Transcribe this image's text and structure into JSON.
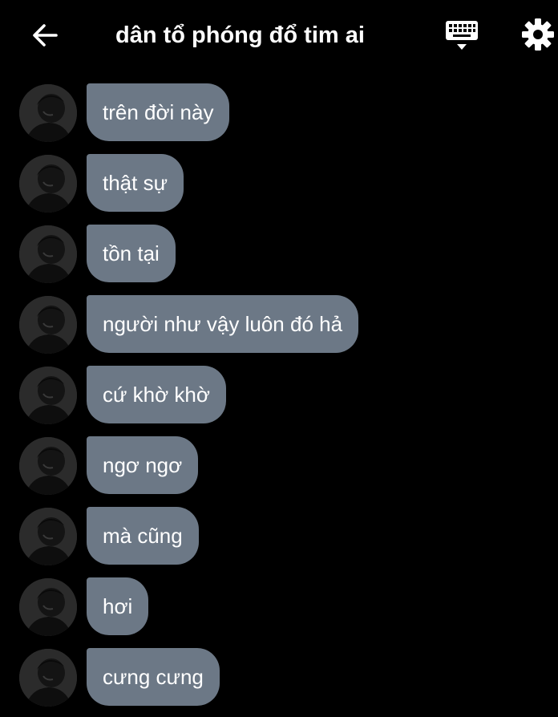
{
  "header": {
    "back_icon": "arrow-left-icon",
    "title": "dân tổ phóng đổ tim ai",
    "keyboard_icon": "keyboard-icon",
    "settings_icon": "gear-icon"
  },
  "colors": {
    "background": "#000000",
    "bubble": "#6c7886",
    "text": "#ffffff"
  },
  "messages": [
    {
      "text": "trên đời này"
    },
    {
      "text": "thật sự"
    },
    {
      "text": "tồn tại"
    },
    {
      "text": "người như vậy luôn đó hả"
    },
    {
      "text": "cứ khờ khờ"
    },
    {
      "text": "ngơ ngơ"
    },
    {
      "text": "mà cũng"
    },
    {
      "text": "hơi"
    },
    {
      "text": "cưng cưng"
    }
  ]
}
